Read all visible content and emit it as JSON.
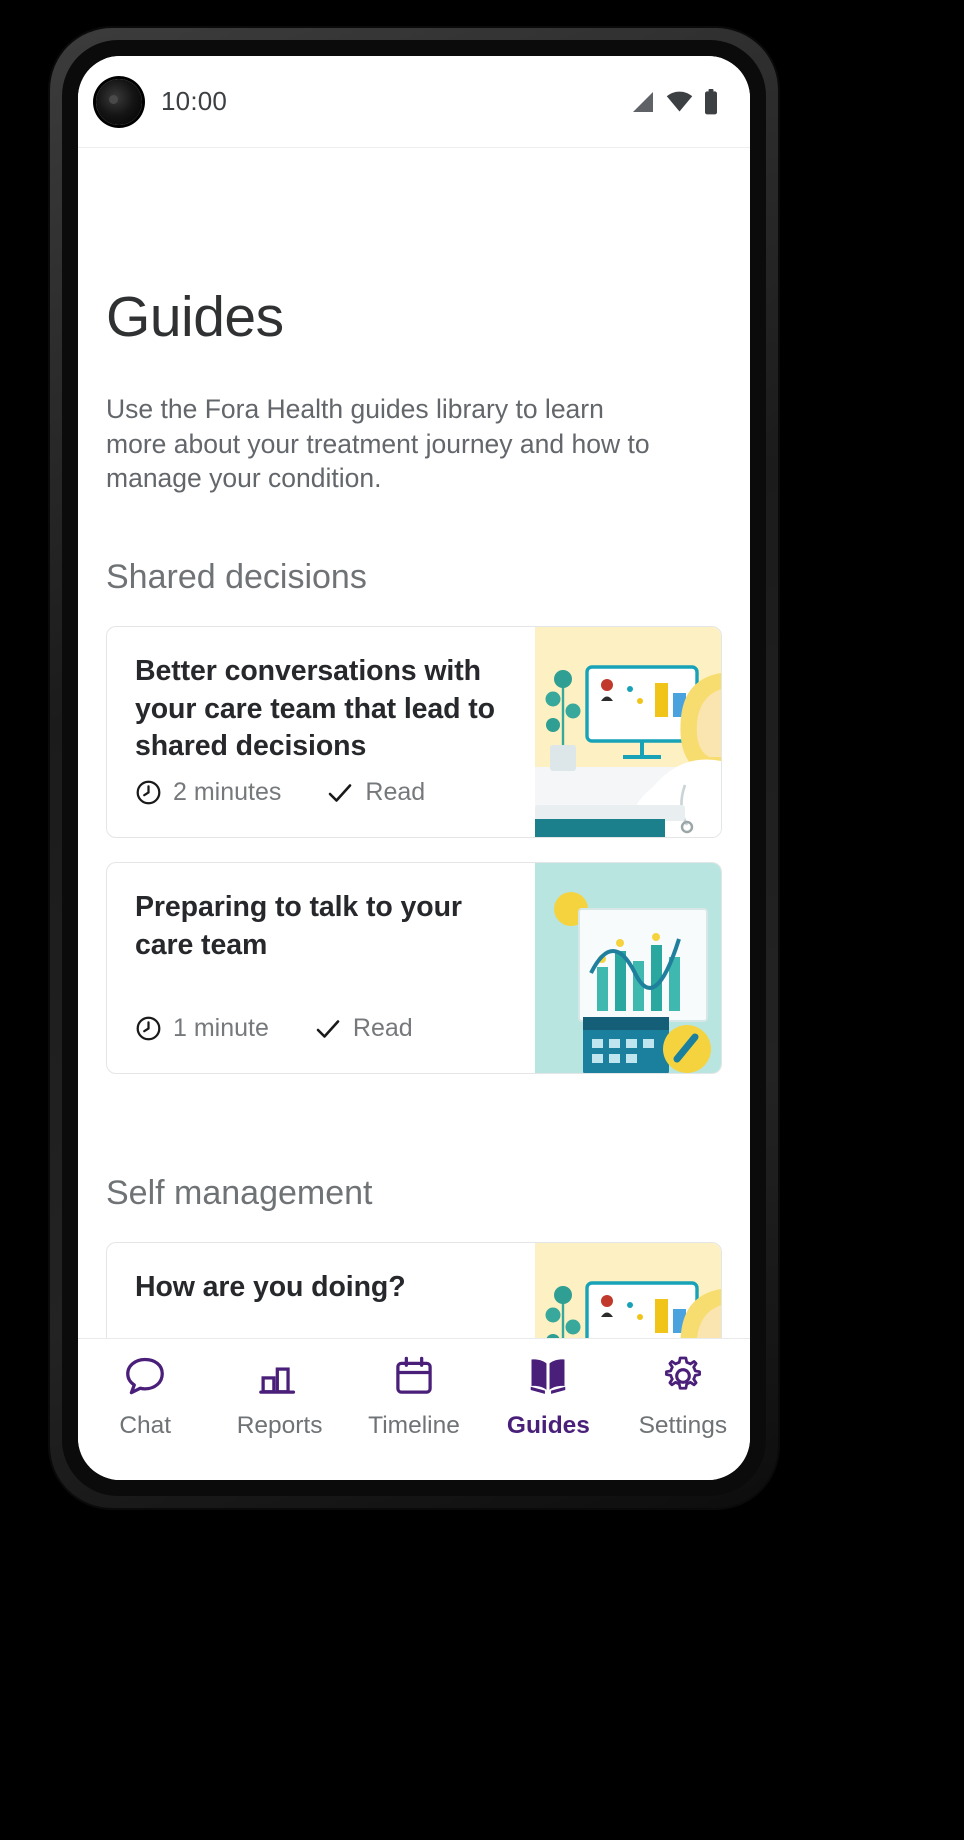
{
  "status_bar": {
    "time": "10:00",
    "icons": [
      "signal-icon",
      "wifi-icon",
      "battery-icon"
    ]
  },
  "page": {
    "title": "Guides",
    "description": "Use the Fora Health guides library to learn more about your treatment journey and how to manage your condition."
  },
  "sections": [
    {
      "title": "Shared decisions",
      "cards": [
        {
          "title": "Better conversations with your care team that lead to shared decisions",
          "duration": "2 minutes",
          "status": "Read",
          "clock_icon": "clock-icon",
          "check_icon": "check-icon",
          "art": "doctor-at-monitor-illustration"
        },
        {
          "title": "Preparing to talk to your care team",
          "duration": "1 minute",
          "status": "Read",
          "clock_icon": "clock-icon",
          "check_icon": "check-icon",
          "art": "chart-and-calendar-illustration"
        }
      ]
    },
    {
      "title": "Self management",
      "cards": [
        {
          "title": "How are you doing?",
          "art": "doctor-at-monitor-illustration"
        }
      ]
    }
  ],
  "bottom_nav": {
    "active": "Guides",
    "items": [
      {
        "label": "Chat",
        "icon": "chat-bubble-icon"
      },
      {
        "label": "Reports",
        "icon": "bar-chart-icon"
      },
      {
        "label": "Timeline",
        "icon": "calendar-icon"
      },
      {
        "label": "Guides",
        "icon": "open-book-icon"
      },
      {
        "label": "Settings",
        "icon": "gear-icon"
      }
    ]
  },
  "colors": {
    "accent_purple": "#4a1f7a",
    "nav_inactive": "#6f7376",
    "title_text": "#2f3133",
    "body_text": "#63676b"
  }
}
